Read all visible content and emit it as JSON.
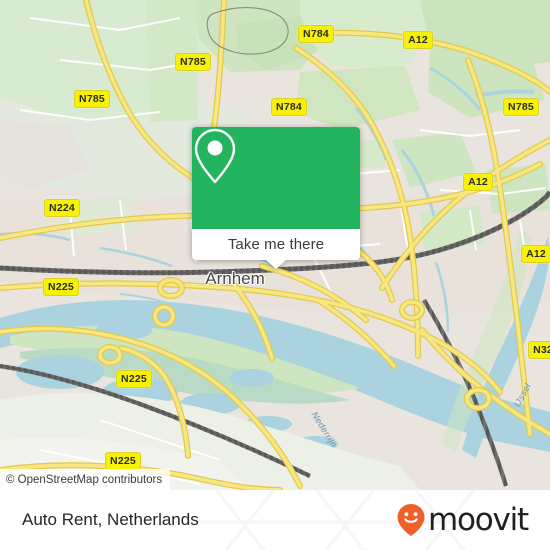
{
  "map": {
    "attribution": "© OpenStreetMap contributors",
    "city_label": "Arnhem",
    "water_labels": [
      {
        "name": "Nederrijn"
      },
      {
        "name": "IJssel"
      }
    ],
    "road_shields": [
      {
        "label": "N784"
      },
      {
        "label": "A12"
      },
      {
        "label": "N785"
      },
      {
        "label": "N785"
      },
      {
        "label": "N784"
      },
      {
        "label": "N785"
      },
      {
        "label": "N785"
      },
      {
        "label": "N224"
      },
      {
        "label": "A12"
      },
      {
        "label": "A12"
      },
      {
        "label": "N225"
      },
      {
        "label": "N225"
      },
      {
        "label": "N32"
      },
      {
        "label": "N225"
      }
    ],
    "colors": {
      "land": "#e9e4de",
      "green": "#cfe7bf",
      "water": "#aad3df",
      "road": "#f7e06e",
      "rail": "#7a7a7a"
    }
  },
  "callout": {
    "button_label": "Take me there",
    "icon": "map-pin-icon",
    "accent_color": "#22b45e"
  },
  "footer": {
    "title": "Auto Rent, Netherlands",
    "brand_name": "moovit",
    "brand_icon": "moovit-pin-smiley-icon",
    "brand_color": "#ee5f2a"
  }
}
